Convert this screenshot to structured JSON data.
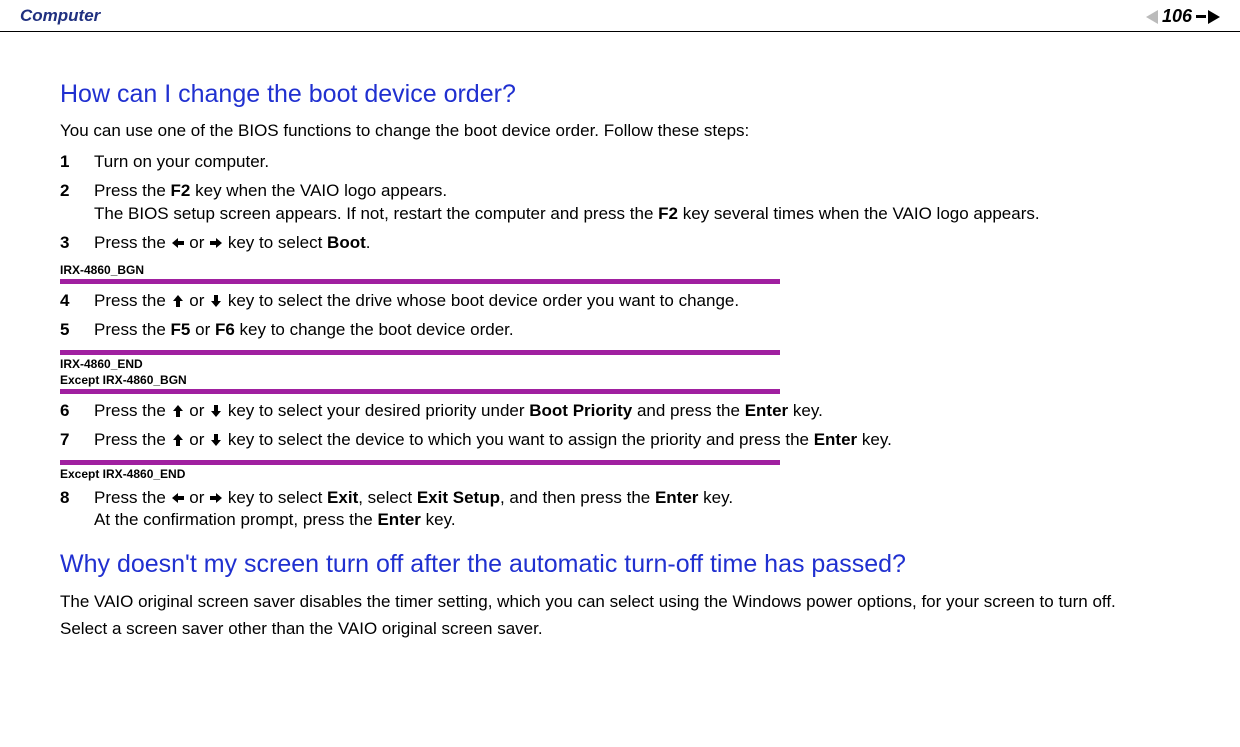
{
  "header": {
    "section": "Computer",
    "page": "106"
  },
  "q1": {
    "title": "How can I change the boot device order?",
    "intro": "You can use one of the BIOS functions to change the boot device order. Follow these steps:",
    "step1": "Turn on your computer.",
    "step2a": "Press the ",
    "step2b": " key when the VAIO logo appears.",
    "step2c": "The BIOS setup screen appears. If not, restart the computer and press the ",
    "step2d": " key several times when the VAIO logo appears.",
    "key_f2": "F2",
    "step3a": "Press the ",
    "step3b": " or ",
    "step3c": " key to select ",
    "word_boot": "Boot",
    "marker1": "IRX-4860_BGN",
    "step4a": "Press the ",
    "step4b": " or ",
    "step4c": " key to select the drive whose boot device order you want to change.",
    "step5a": "Press the ",
    "key_f5": "F5",
    "step5b": " or ",
    "key_f6": "F6",
    "step5c": " key to change the boot device order.",
    "marker2a": "IRX-4860_END",
    "marker2b": "Except IRX-4860_BGN",
    "step6a": "Press the ",
    "step6b": " or ",
    "step6c": " key to select your desired priority under ",
    "word_boot_priority": "Boot Priority",
    "step6d": " and press the ",
    "word_enter": "Enter",
    "step6e": " key.",
    "step7a": "Press the ",
    "step7b": " or ",
    "step7c": " key to select the device to which you want to assign the priority and press the ",
    "step7d": " key.",
    "marker3": "Except IRX-4860_END",
    "step8a": "Press the ",
    "step8b": " or ",
    "step8c": " key to select ",
    "word_exit": "Exit",
    "step8d": ", select ",
    "word_exit_setup": "Exit Setup",
    "step8e": ", and then press the ",
    "step8f": " key.",
    "step8g": "At the confirmation prompt, press the ",
    "step8h": " key."
  },
  "q2": {
    "title": "Why doesn't my screen turn off after the automatic turn-off time has passed?",
    "body1": "The VAIO original screen saver disables the timer setting, which you can select using the Windows power options, for your screen to turn off.",
    "body2": "Select a screen saver other than the VAIO original screen saver."
  }
}
